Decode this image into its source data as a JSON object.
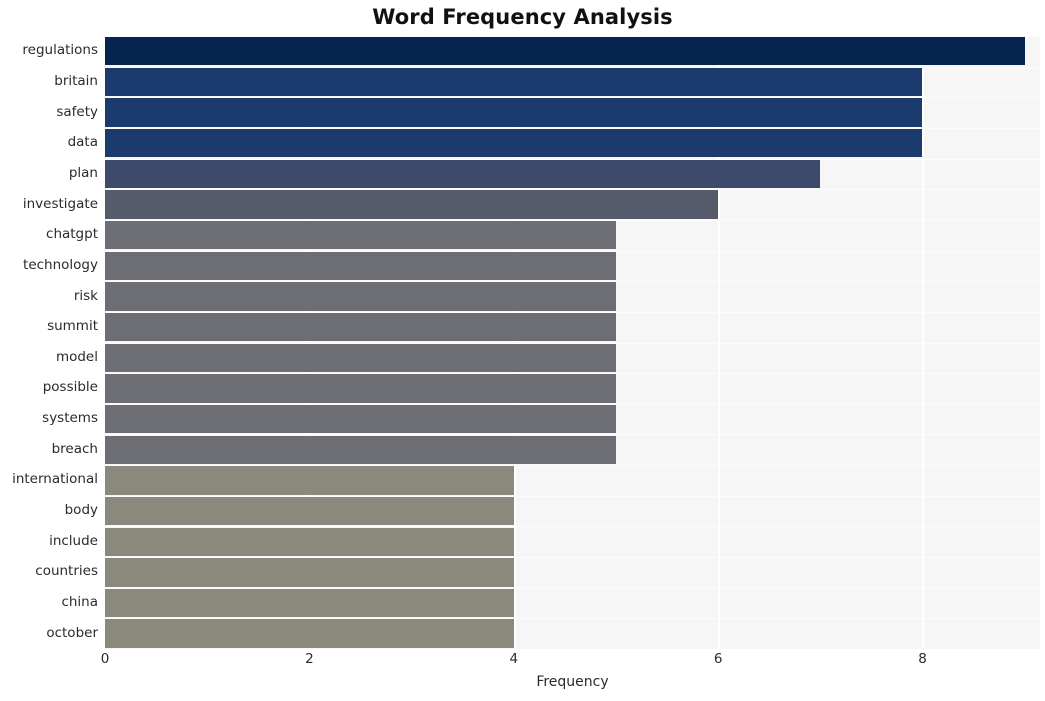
{
  "chart_data": {
    "type": "bar",
    "orientation": "horizontal",
    "title": "Word Frequency Analysis",
    "xlabel": "Frequency",
    "ylabel": "",
    "xlim": [
      0,
      9.15
    ],
    "ylim": [
      0,
      20
    ],
    "grid": true,
    "legend": false,
    "xticks": [
      0,
      2,
      4,
      6,
      8
    ],
    "xtick_labels": [
      "0",
      "2",
      "4",
      "6",
      "8"
    ],
    "categories": [
      "regulations",
      "britain",
      "safety",
      "data",
      "plan",
      "investigate",
      "chatgpt",
      "technology",
      "risk",
      "summit",
      "model",
      "possible",
      "systems",
      "breach",
      "international",
      "body",
      "include",
      "countries",
      "china",
      "october"
    ],
    "values": [
      9,
      8,
      8,
      8,
      7,
      6,
      5,
      5,
      5,
      5,
      5,
      5,
      5,
      5,
      4,
      4,
      4,
      4,
      4,
      4
    ],
    "bar_colors": [
      "#062450",
      "#1b3a6e",
      "#1b3a6e",
      "#1b3a6e",
      "#3d4a6b",
      "#555b6b",
      "#6c6e73",
      "#6c6e73",
      "#6c6e73",
      "#6c6e73",
      "#6c6e73",
      "#6c6e73",
      "#6c6e73",
      "#6c6e73",
      "#8b897c",
      "#8b897c",
      "#8b897c",
      "#8b897c",
      "#8b897c",
      "#8b897c"
    ],
    "plot_background": "#f6f6f7",
    "figure_background": "#ffffff",
    "gridline_color": "#ffffff",
    "text_color": "#2b2b2b",
    "title_color": "#111111"
  }
}
